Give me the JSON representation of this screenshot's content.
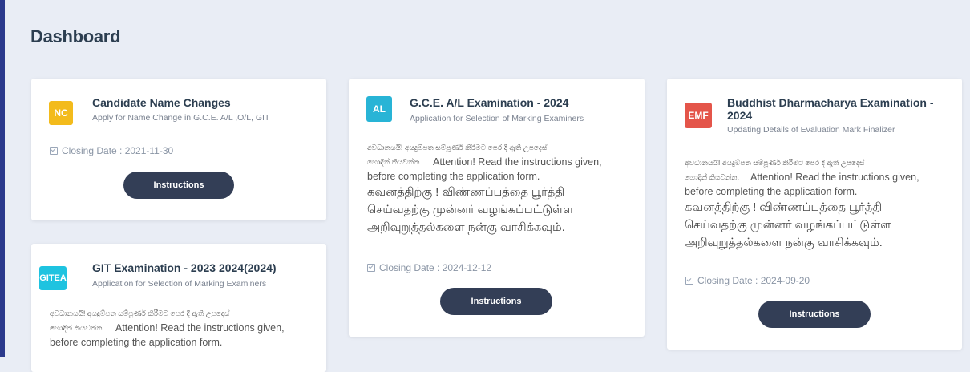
{
  "page": {
    "title": "Dashboard"
  },
  "colors": {
    "sidebar_accent": "#2b3a8c",
    "button": "#333e56",
    "nc": "#f3bb1c",
    "al": "#28b4d6",
    "emf": "#e4554a",
    "gitea": "#1ec3e0"
  },
  "cards": [
    {
      "badge": "NC",
      "title": "Candidate Name Changes",
      "subtitle": "Apply for Name Change in G.C.E. A/L ,O/L, GIT",
      "closing": "Closing Date : 2021-11-30",
      "button": "Instructions"
    },
    {
      "badge": "GITEA",
      "title": "GIT Examination - 2023 2024(2024)",
      "subtitle": "Application for Selection of Marking Examiners",
      "sinhala": "අවධානයයි! අයදුම්පත සම්පූර්ණ කිරීමට පෙර දී ඇති උපදෙස්",
      "sinhala2": "හොඳින් කියවන්න.",
      "english1": "Attention! Read the instructions given,",
      "english2": "before completing the application form."
    },
    {
      "badge": "AL",
      "title": "G.C.E. A/L Examination - 2024",
      "subtitle": "Application for Selection of Marking Examiners",
      "sinhala": "අවධානයයි! අයදුම්පත සම්පූර්ණ කිරීමට පෙර දී ඇති උපදෙස්",
      "sinhala2": "හොඳින් කියවන්න.",
      "english1": "Attention! Read the instructions given,",
      "english2": "before completing the application form.",
      "tamil1": "கவனத்திற்கு ! விண்ணப்பத்தை பூர்த்தி",
      "tamil2": "செய்வதற்கு முன்னர் வழங்கப்பட்டுள்ள",
      "tamil3": "அறிவுறுத்தல்களை நன்கு வாசிக்கவும்.",
      "closing": "Closing Date : 2024-12-12",
      "button": "Instructions"
    },
    {
      "badge": "EMF",
      "title1": "Buddhist Dharmacharya Examination -",
      "title2": "2024",
      "subtitle": "Updating Details of Evaluation Mark Finalizer",
      "sinhala": "අවධානයයි! අයදුම්පත සම්පූර්ණ කිරීමට පෙර දී ඇති උපදෙස්",
      "sinhala2": "හොඳින් කියවන්න.",
      "english1": "Attention! Read the instructions given,",
      "english2": "before completing the application form.",
      "tamil1": "கவனத்திற்கு ! விண்ணப்பத்தை பூர்த்தி",
      "tamil2": "செய்வதற்கு முன்னர் வழங்கப்பட்டுள்ள",
      "tamil3": "அறிவுறுத்தல்களை நன்கு வாசிக்கவும்.",
      "closing": "Closing Date : 2024-09-20",
      "button": "Instructions"
    }
  ]
}
